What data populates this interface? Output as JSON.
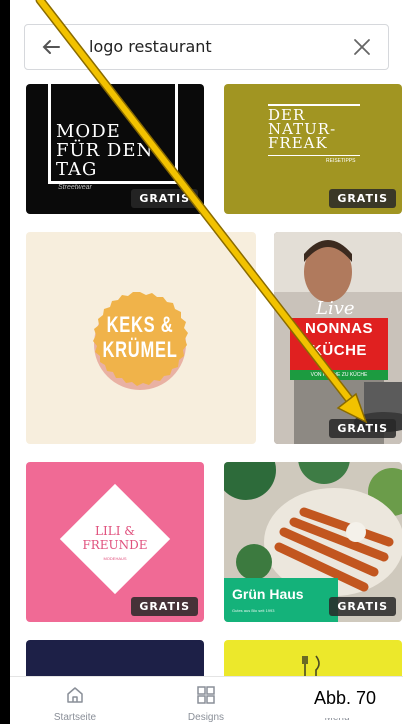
{
  "search": {
    "query": "logo restaurant"
  },
  "tiles": {
    "mode": {
      "title_l1": "MODE",
      "title_l2": "FÜR DEN",
      "title_l3": "TAG",
      "sub": "Streetwear",
      "badge": "GRATIS"
    },
    "natur": {
      "title_l1": "DER",
      "title_l2": "NATUR-",
      "title_l3": "FREAK",
      "sub": "REISETIPPS",
      "badge": "GRATIS"
    },
    "keks": {
      "line1": "KEKS &",
      "line2": "KRÜMEL"
    },
    "nonnas": {
      "live": "Live",
      "line1": "NONNAS",
      "line2": "KÜCHE",
      "sub": "VON KÜCHE ZU KÜCHE",
      "badge": "GRATIS"
    },
    "lili": {
      "line1": "LILI &",
      "line2": "FREUNDE",
      "sub": "MODEHAUS",
      "badge": "GRATIS"
    },
    "grun": {
      "title": "Grün Haus",
      "sub": "Gutes aus Bio seit 1993",
      "badge": "GRATIS"
    }
  },
  "nav": {
    "home": "Startseite",
    "designs": "Designs",
    "menu": "Menü"
  },
  "caption": "Abb. 70",
  "colors": {
    "accent_arrow": "#f2c200",
    "pink": "#f06a95",
    "olive": "#a19522",
    "green": "#14b27a",
    "red": "#e02020"
  }
}
